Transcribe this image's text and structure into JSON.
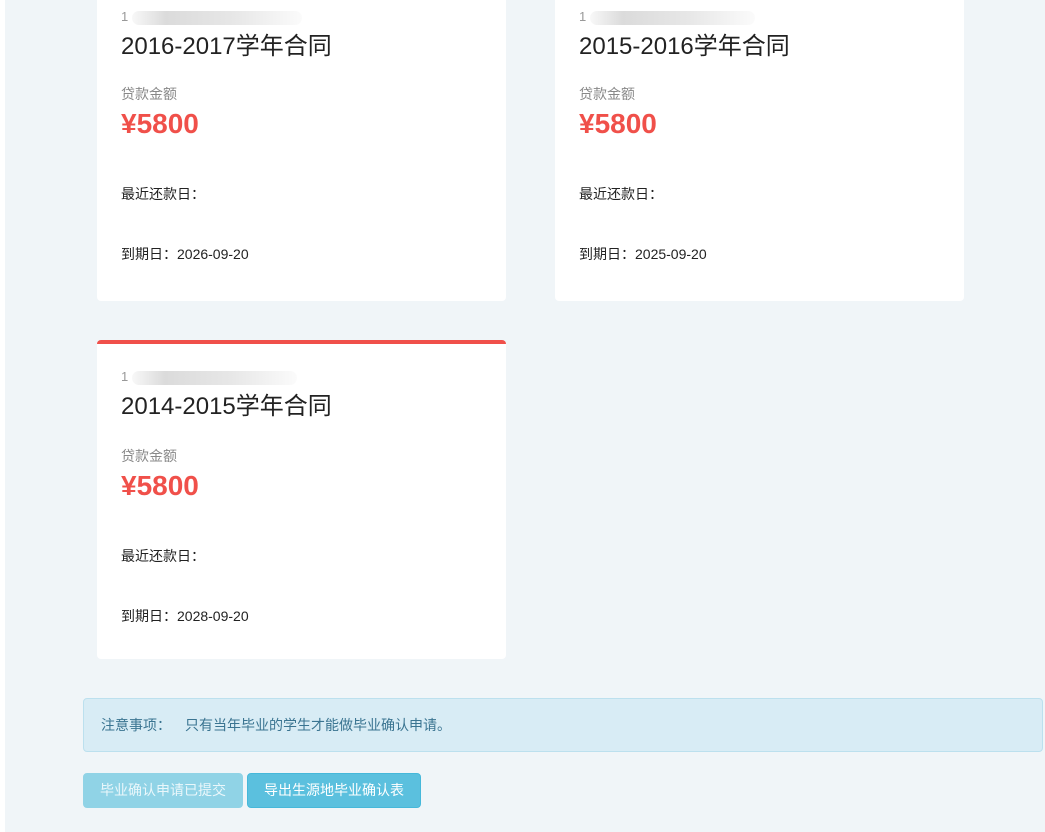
{
  "cards": [
    {
      "contract_title": "2016-2017学年合同",
      "redacted_prefix": "1",
      "amount_label": "贷款金额",
      "amount": "¥5800",
      "recent_repay_label": "最近还款日：",
      "recent_repay_value": "",
      "due_label": "到期日：",
      "due_value": "2026-09-20",
      "active": false
    },
    {
      "contract_title": "2015-2016学年合同",
      "redacted_prefix": "1",
      "amount_label": "贷款金额",
      "amount": "¥5800",
      "recent_repay_label": "最近还款日：",
      "recent_repay_value": "",
      "due_label": "到期日：",
      "due_value": "2025-09-20",
      "active": false
    },
    {
      "contract_title": "2014-2015学年合同",
      "redacted_prefix": "1",
      "amount_label": "贷款金额",
      "amount": "¥5800",
      "recent_repay_label": "最近还款日：",
      "recent_repay_value": "",
      "due_label": "到期日：",
      "due_value": "2028-09-20",
      "active": true
    }
  ],
  "notice": {
    "label": "注意事项：",
    "text": "只有当年毕业的学生才能做毕业确认申请。"
  },
  "buttons": {
    "submitted_label": "毕业确认申请已提交",
    "export_label": "导出生源地毕业确认表"
  },
  "colors": {
    "accent_red": "#f0504a",
    "info_blue": "#5bc0de",
    "page_bg": "#f0f5f8"
  }
}
